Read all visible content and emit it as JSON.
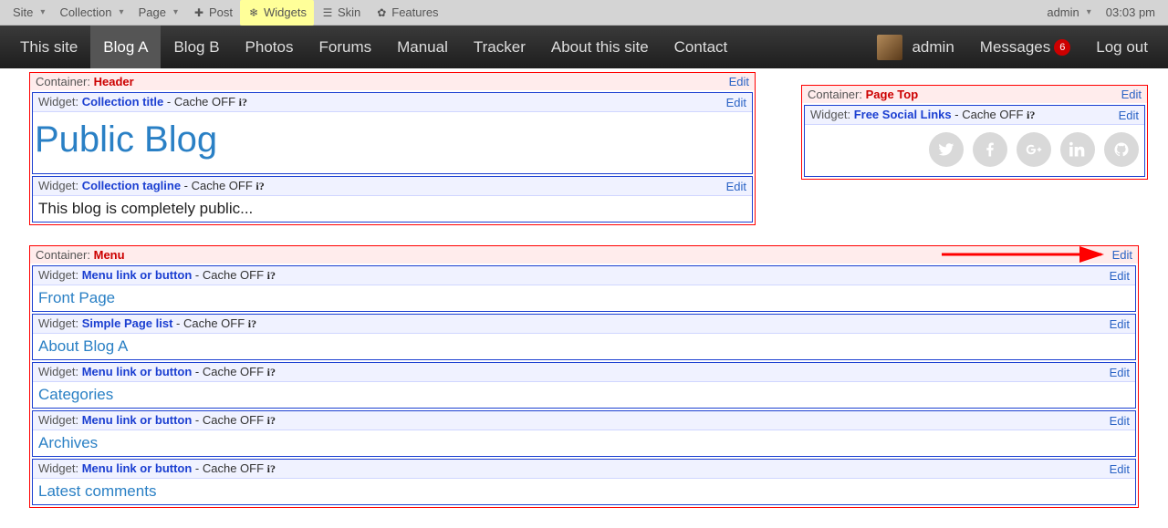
{
  "toolbar": {
    "site": "Site",
    "collection": "Collection",
    "page": "Page",
    "post": "Post",
    "widgets": "Widgets",
    "skin": "Skin",
    "features": "Features",
    "user": "admin",
    "time": "03:03 pm"
  },
  "nav": {
    "items": [
      {
        "label": "This site"
      },
      {
        "label": "Blog A"
      },
      {
        "label": "Blog B"
      },
      {
        "label": "Photos"
      },
      {
        "label": "Forums"
      },
      {
        "label": "Manual"
      },
      {
        "label": "Tracker"
      },
      {
        "label": "About this site"
      },
      {
        "label": "Contact"
      }
    ],
    "user": "admin",
    "messages": "Messages",
    "messages_count": "6",
    "logout": "Log out"
  },
  "header_container": {
    "label": "Container:",
    "name": "Header",
    "edit": "Edit",
    "title_widget": {
      "label": "Widget:",
      "name": "Collection title",
      "cache": "- Cache OFF",
      "info": "i?",
      "edit": "Edit",
      "value": "Public Blog"
    },
    "tagline_widget": {
      "label": "Widget:",
      "name": "Collection tagline",
      "cache": "- Cache OFF",
      "info": "i?",
      "edit": "Edit",
      "value": "This blog is completely public..."
    }
  },
  "pagetop_container": {
    "label": "Container:",
    "name": "Page Top",
    "edit": "Edit",
    "social_widget": {
      "label": "Widget:",
      "name": "Free Social Links",
      "cache": "- Cache OFF",
      "info": "i?",
      "edit": "Edit"
    }
  },
  "menu_container": {
    "label": "Container:",
    "name": "Menu",
    "edit": "Edit",
    "widgets": [
      {
        "wlabel": "Widget:",
        "name": "Menu link or button",
        "cache": "- Cache OFF",
        "info": "i?",
        "edit": "Edit",
        "value": "Front Page"
      },
      {
        "wlabel": "Widget:",
        "name": "Simple Page list",
        "cache": "- Cache OFF",
        "info": "i?",
        "edit": "Edit",
        "value": "About Blog A"
      },
      {
        "wlabel": "Widget:",
        "name": "Menu link or button",
        "cache": "- Cache OFF",
        "info": "i?",
        "edit": "Edit",
        "value": "Categories"
      },
      {
        "wlabel": "Widget:",
        "name": "Menu link or button",
        "cache": "- Cache OFF",
        "info": "i?",
        "edit": "Edit",
        "value": "Archives"
      },
      {
        "wlabel": "Widget:",
        "name": "Menu link or button",
        "cache": "- Cache OFF",
        "info": "i?",
        "edit": "Edit",
        "value": "Latest comments"
      }
    ]
  }
}
